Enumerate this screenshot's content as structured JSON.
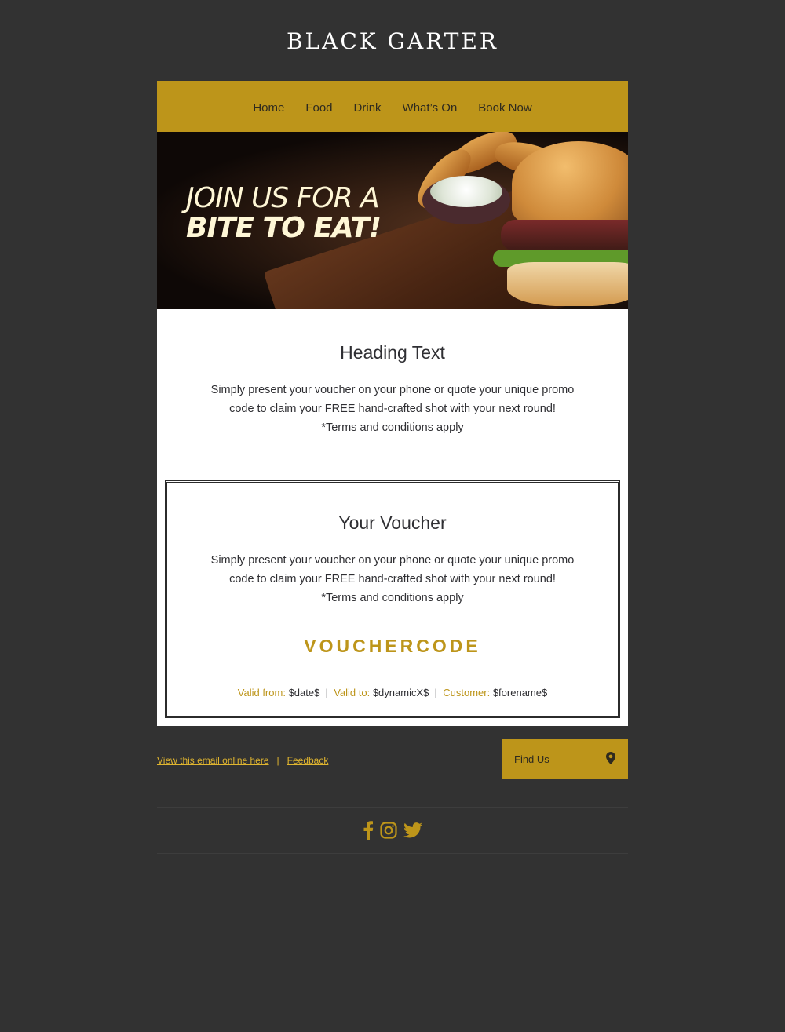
{
  "brand": {
    "name": "BLACK GARTER"
  },
  "nav": {
    "items": [
      "Home",
      "Food",
      "Drink",
      "What’s On",
      "Book Now"
    ]
  },
  "hero": {
    "line1": "JOIN US FOR A",
    "line2": "BITE TO EAT!"
  },
  "intro": {
    "heading": "Heading Text",
    "line1": "Simply present your voucher on your phone or quote your unique promo",
    "line2": "code to claim your FREE hand-crafted shot with your next round!",
    "line3": "*Terms and conditions apply"
  },
  "voucher": {
    "heading": "Your Voucher",
    "line1": "Simply present your voucher on your phone or quote your unique promo",
    "line2": "code to claim your FREE hand-crafted shot with your next round!",
    "line3": "*Terms and conditions apply",
    "code": "VOUCHERCODE",
    "valid_from_label": "Valid from:",
    "valid_from_value": "$date$",
    "valid_to_label": "Valid to:",
    "valid_to_value": "$dynamicX$",
    "customer_label": "Customer:",
    "customer_value": "$forename$",
    "separator": "|"
  },
  "footer": {
    "view_online": "View this email online here",
    "separator": "|",
    "feedback": "Feedback",
    "find_us": "Find Us",
    "find_us_icon": "map-pin-icon",
    "social_icons": [
      "facebook-icon",
      "instagram-icon",
      "twitter-icon"
    ]
  },
  "colors": {
    "accent": "#bd951a",
    "background": "#323232",
    "card": "#ffffff",
    "link": "#e0b52f"
  }
}
